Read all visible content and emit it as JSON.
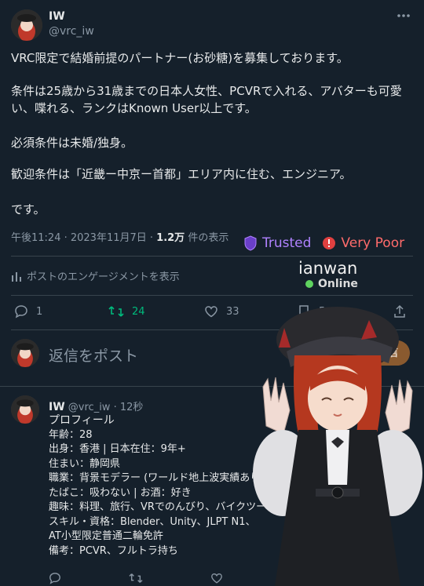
{
  "tweet": {
    "author_name": "IW",
    "handle": "@vrc_iw",
    "more_icon": "more-horizontal-icon",
    "paragraphs": [
      "VRC限定で結婚前提のパートナー(お砂糖)を募集しております。",
      "条件は25歳から31歳までの日本人女性、PCVRで入れる、アバターも可愛い、喋れる、ランクはKnown User以上です。",
      "必須条件は未婚/独身。",
      "歓迎条件は「近畿ー中京ー首都」エリア内に住む、エンジニア。",
      "です。"
    ],
    "meta_time": "午後11:24 · 2023年11月7日 · ",
    "views_count": "1.2万",
    "views_label": " 件の表示",
    "engagement_label": "ポストのエンゲージメントを表示",
    "actions": {
      "reply_count": "1",
      "retweet_count": "24",
      "like_count": "33",
      "bookmark_count": "5"
    }
  },
  "reply_composer": {
    "placeholder": "返信をポスト",
    "button_label": "返信"
  },
  "reply": {
    "author_name": "IW",
    "handle": "@vrc_iw",
    "time": "· 12秒",
    "lines": [
      "プロフィール",
      "年齢：28",
      "出身：香港 | 日本在住：9年+",
      "住まい：静岡県",
      "職業：背景モデラー (ワールド地上波実績あり)",
      "たばこ：吸わない | お酒：好き",
      "趣味：料理、旅行、VRでのんびり、バイクツーリング",
      "スキル・資格：Blender、Unity、JLPT N1、",
      "AT小型限定普通二輪免許",
      "備考：PCVR、フルトラ持ち"
    ]
  },
  "vrc_overlay": {
    "trust_label": "Trusted",
    "rank_label": "Very Poor",
    "username": "ianwan",
    "status": "Online",
    "colors": {
      "trusted": "#b082ff",
      "poor": "#ff6b6b",
      "online": "#5fd35f"
    }
  }
}
